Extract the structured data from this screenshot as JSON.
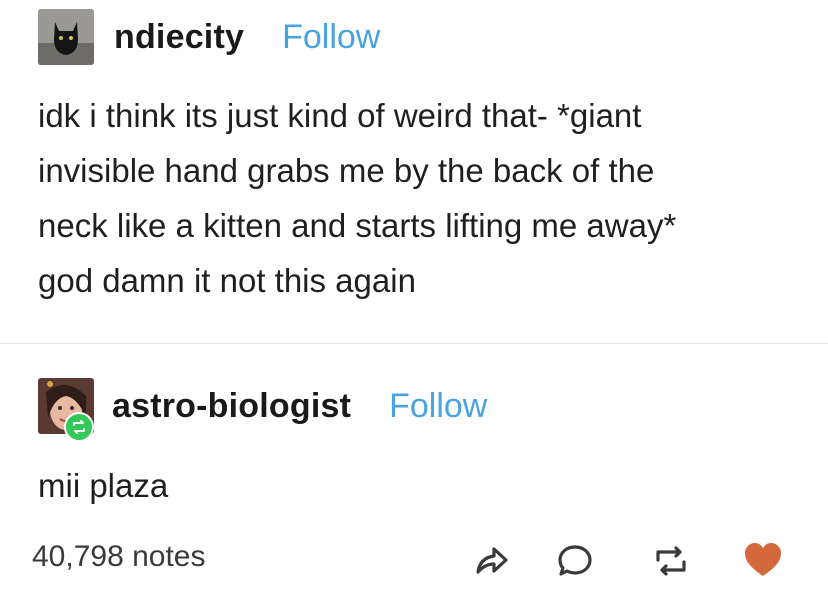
{
  "posts": [
    {
      "username": "ndiecity",
      "follow_label": "Follow",
      "text": "idk i think its just kind of weird that- *giant\ninvisible hand grabs me by the back of the\nneck like a kitten and starts lifting me away*\ngod damn it not this again"
    },
    {
      "username": "astro-biologist",
      "follow_label": "Follow",
      "text": "mii plaza"
    }
  ],
  "footer": {
    "notes": "40,798 notes"
  },
  "icons": {
    "share": "share-icon",
    "reply": "reply-icon",
    "reblog": "reblog-icon",
    "like": "heart-icon"
  },
  "colors": {
    "follow": "#4aa3df",
    "heart": "#d4693d",
    "reblog_badge": "#34c759"
  }
}
